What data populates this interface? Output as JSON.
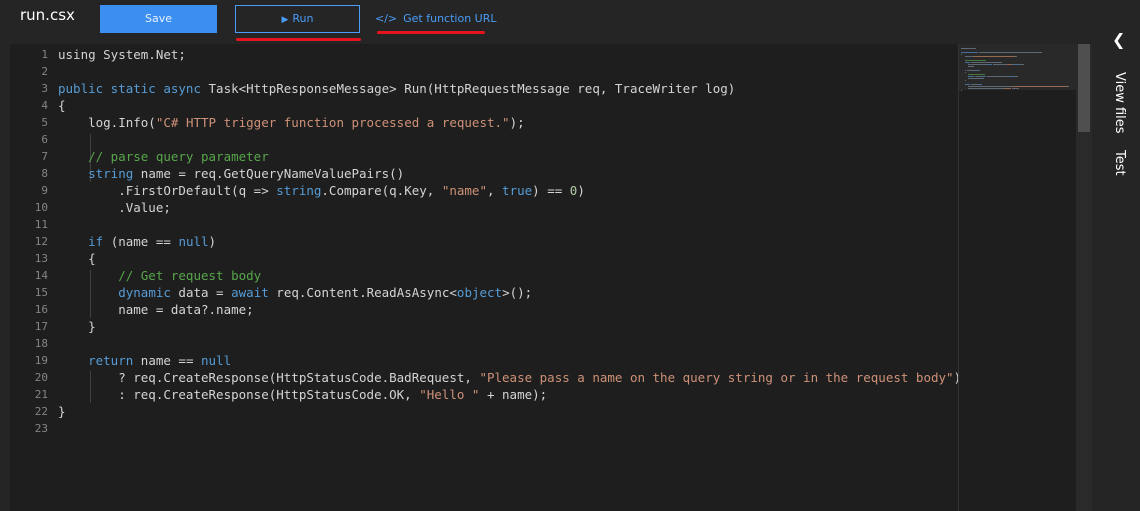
{
  "header": {
    "file_name": "run.csx",
    "save_label": "Save",
    "run_label": "Run",
    "run_icon": "play-icon",
    "url_label": "Get function URL",
    "url_icon": "code-brackets-icon"
  },
  "side_panel": {
    "view_files_label": "View files",
    "test_label": "Test",
    "collapse_icon": "chevron-left-icon"
  },
  "colors": {
    "accent": "#3b8ff0",
    "link": "#4a9cf7",
    "highlight_underline": "#e5141c",
    "editor_bg": "#1e1e1e",
    "keyword": "#569cd6",
    "string": "#ce9178",
    "comment": "#57a64a"
  },
  "code": {
    "lines": [
      [
        [
          "using System.Net;",
          ""
        ]
      ],
      [],
      [
        [
          "public static async",
          "kw"
        ],
        [
          " Task<HttpResponseMessage> Run(HttpRequestMessage req, TraceWriter log)",
          ""
        ]
      ],
      [
        [
          "{",
          ""
        ]
      ],
      [
        [
          "    log.Info(",
          ""
        ],
        [
          "\"C# HTTP trigger function processed a request.\"",
          "str"
        ],
        [
          ");",
          ""
        ]
      ],
      [],
      [
        [
          "    // parse query parameter",
          "cmt"
        ]
      ],
      [
        [
          "    ",
          ""
        ],
        [
          "string",
          "kw"
        ],
        [
          " name = req.GetQueryNameValuePairs()",
          ""
        ]
      ],
      [
        [
          "        .FirstOrDefault(q => ",
          ""
        ],
        [
          "string",
          "kw"
        ],
        [
          ".Compare(q.Key, ",
          ""
        ],
        [
          "\"name\"",
          "str"
        ],
        [
          ", ",
          ""
        ],
        [
          "true",
          "kw"
        ],
        [
          ") == ",
          ""
        ],
        [
          "0",
          "num"
        ],
        [
          ")",
          ""
        ]
      ],
      [
        [
          "        .Value;",
          ""
        ]
      ],
      [],
      [
        [
          "    ",
          ""
        ],
        [
          "if",
          "kw"
        ],
        [
          " (name == ",
          ""
        ],
        [
          "null",
          "kw"
        ],
        [
          ")",
          ""
        ]
      ],
      [
        [
          "    {",
          ""
        ]
      ],
      [
        [
          "        // Get request body",
          "cmt"
        ]
      ],
      [
        [
          "        ",
          ""
        ],
        [
          "dynamic",
          "kw"
        ],
        [
          " data = ",
          ""
        ],
        [
          "await",
          "kw"
        ],
        [
          " req.Content.ReadAsAsync<",
          ""
        ],
        [
          "object",
          "kw"
        ],
        [
          ">();",
          ""
        ]
      ],
      [
        [
          "        name = data?.name;",
          ""
        ]
      ],
      [
        [
          "    }",
          ""
        ]
      ],
      [],
      [
        [
          "    ",
          ""
        ],
        [
          "return",
          "kw"
        ],
        [
          " name == ",
          ""
        ],
        [
          "null",
          "kw"
        ]
      ],
      [
        [
          "        ? req.CreateResponse(HttpStatusCode.BadRequest, ",
          ""
        ],
        [
          "\"Please pass a name on the query string or in the request body\"",
          "str"
        ],
        [
          ")",
          ""
        ]
      ],
      [
        [
          "        : req.CreateResponse(HttpStatusCode.OK, ",
          ""
        ],
        [
          "\"Hello \"",
          "str"
        ],
        [
          " + name);",
          ""
        ]
      ],
      [
        [
          "}",
          ""
        ]
      ],
      []
    ]
  }
}
